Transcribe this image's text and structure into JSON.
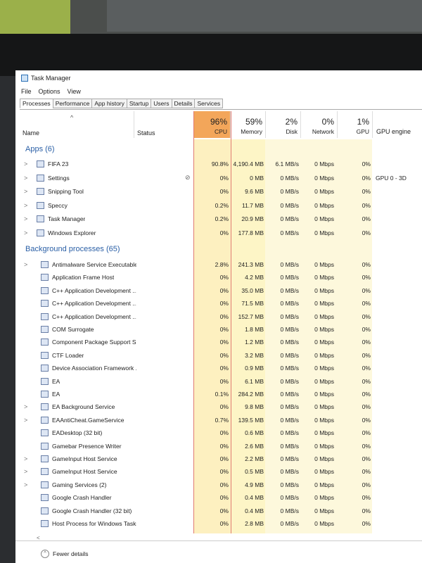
{
  "window": {
    "title": "Task Manager"
  },
  "menu": [
    "File",
    "Options",
    "View"
  ],
  "tabs": [
    "Processes",
    "Performance",
    "App history",
    "Startup",
    "Users",
    "Details",
    "Services"
  ],
  "columns": {
    "name": "Name",
    "status": "Status",
    "cpu": {
      "pct": "96%",
      "label": "CPU"
    },
    "memory": {
      "pct": "59%",
      "label": "Memory"
    },
    "disk": {
      "pct": "2%",
      "label": "Disk"
    },
    "network": {
      "pct": "0%",
      "label": "Network"
    },
    "gpu": {
      "pct": "1%",
      "label": "GPU"
    },
    "gpu_engine": "GPU engine"
  },
  "groups": {
    "apps": "Apps (6)",
    "background": "Background processes (65)"
  },
  "apps": [
    {
      "name": "FIFA 23",
      "cpu": "90.8%",
      "mem": "4,190.4 MB",
      "disk": "6.1 MB/s",
      "net": "0 Mbps",
      "gpu": "0%",
      "engine": ""
    },
    {
      "name": "Settings",
      "cpu": "0%",
      "mem": "0 MB",
      "disk": "0 MB/s",
      "net": "0 Mbps",
      "gpu": "0%",
      "engine": "GPU 0 - 3D"
    },
    {
      "name": "Snipping Tool",
      "cpu": "0%",
      "mem": "9.6 MB",
      "disk": "0 MB/s",
      "net": "0 Mbps",
      "gpu": "0%",
      "engine": ""
    },
    {
      "name": "Speccy",
      "cpu": "0.2%",
      "mem": "11.7 MB",
      "disk": "0 MB/s",
      "net": "0 Mbps",
      "gpu": "0%",
      "engine": ""
    },
    {
      "name": "Task Manager",
      "cpu": "0.2%",
      "mem": "20.9 MB",
      "disk": "0 MB/s",
      "net": "0 Mbps",
      "gpu": "0%",
      "engine": ""
    },
    {
      "name": "Windows Explorer",
      "cpu": "0%",
      "mem": "177.8 MB",
      "disk": "0 MB/s",
      "net": "0 Mbps",
      "gpu": "0%",
      "engine": ""
    }
  ],
  "background": [
    {
      "name": "Antimalware Service Executable",
      "cpu": "2.8%",
      "mem": "241.3 MB",
      "disk": "0 MB/s",
      "net": "0 Mbps",
      "gpu": "0%"
    },
    {
      "name": "Application Frame Host",
      "cpu": "0%",
      "mem": "4.2 MB",
      "disk": "0 MB/s",
      "net": "0 Mbps",
      "gpu": "0%"
    },
    {
      "name": "C++ Application Development ...",
      "cpu": "0%",
      "mem": "35.0 MB",
      "disk": "0 MB/s",
      "net": "0 Mbps",
      "gpu": "0%"
    },
    {
      "name": "C++ Application Development ...",
      "cpu": "0%",
      "mem": "71.5 MB",
      "disk": "0 MB/s",
      "net": "0 Mbps",
      "gpu": "0%"
    },
    {
      "name": "C++ Application Development ...",
      "cpu": "0%",
      "mem": "152.7 MB",
      "disk": "0 MB/s",
      "net": "0 Mbps",
      "gpu": "0%"
    },
    {
      "name": "COM Surrogate",
      "cpu": "0%",
      "mem": "1.8 MB",
      "disk": "0 MB/s",
      "net": "0 Mbps",
      "gpu": "0%"
    },
    {
      "name": "Component Package Support S...",
      "cpu": "0%",
      "mem": "1.2 MB",
      "disk": "0 MB/s",
      "net": "0 Mbps",
      "gpu": "0%"
    },
    {
      "name": "CTF Loader",
      "cpu": "0%",
      "mem": "3.2 MB",
      "disk": "0 MB/s",
      "net": "0 Mbps",
      "gpu": "0%"
    },
    {
      "name": "Device Association Framework ...",
      "cpu": "0%",
      "mem": "0.9 MB",
      "disk": "0 MB/s",
      "net": "0 Mbps",
      "gpu": "0%"
    },
    {
      "name": "EA",
      "cpu": "0%",
      "mem": "6.1 MB",
      "disk": "0 MB/s",
      "net": "0 Mbps",
      "gpu": "0%"
    },
    {
      "name": "EA",
      "cpu": "0.1%",
      "mem": "284.2 MB",
      "disk": "0 MB/s",
      "net": "0 Mbps",
      "gpu": "0%"
    },
    {
      "name": "EA Background Service",
      "cpu": "0%",
      "mem": "9.8 MB",
      "disk": "0 MB/s",
      "net": "0 Mbps",
      "gpu": "0%"
    },
    {
      "name": "EAAntiCheat.GameService",
      "cpu": "0.7%",
      "mem": "139.5 MB",
      "disk": "0 MB/s",
      "net": "0 Mbps",
      "gpu": "0%"
    },
    {
      "name": "EADesktop (32 bit)",
      "cpu": "0%",
      "mem": "0.6 MB",
      "disk": "0 MB/s",
      "net": "0 Mbps",
      "gpu": "0%"
    },
    {
      "name": "Gamebar Presence Writer",
      "cpu": "0%",
      "mem": "2.6 MB",
      "disk": "0 MB/s",
      "net": "0 Mbps",
      "gpu": "0%"
    },
    {
      "name": "GameInput Host Service",
      "cpu": "0%",
      "mem": "2.2 MB",
      "disk": "0 MB/s",
      "net": "0 Mbps",
      "gpu": "0%"
    },
    {
      "name": "GameInput Host Service",
      "cpu": "0%",
      "mem": "0.5 MB",
      "disk": "0 MB/s",
      "net": "0 Mbps",
      "gpu": "0%"
    },
    {
      "name": "Gaming Services (2)",
      "cpu": "0%",
      "mem": "4.9 MB",
      "disk": "0 MB/s",
      "net": "0 Mbps",
      "gpu": "0%"
    },
    {
      "name": "Google Crash Handler",
      "cpu": "0%",
      "mem": "0.4 MB",
      "disk": "0 MB/s",
      "net": "0 Mbps",
      "gpu": "0%"
    },
    {
      "name": "Google Crash Handler (32 bit)",
      "cpu": "0%",
      "mem": "0.4 MB",
      "disk": "0 MB/s",
      "net": "0 Mbps",
      "gpu": "0%"
    },
    {
      "name": "Host Process for Windows Tasks",
      "cpu": "0%",
      "mem": "2.8 MB",
      "disk": "0 MB/s",
      "net": "0 Mbps",
      "gpu": "0%"
    }
  ],
  "footer": {
    "fewer_details": "Fewer details"
  },
  "colors": {
    "cpu_header": "#f3a65a",
    "heat_light": "#fdf5c6",
    "heat_hot": "#f0a04b",
    "group_blue": "#2a5fa6",
    "cpu_border": "#e07a70"
  }
}
